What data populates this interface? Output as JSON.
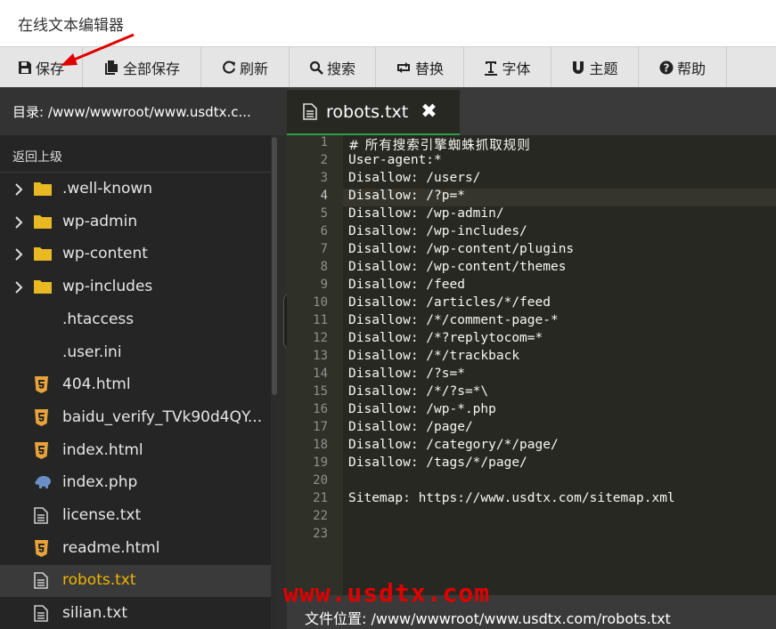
{
  "app": {
    "title": "在线文本编辑器"
  },
  "toolbar": {
    "buttons": [
      {
        "label": "保存",
        "icon": "save-icon"
      },
      {
        "label": "全部保存",
        "icon": "save-all-icon"
      },
      {
        "label": "刷新",
        "icon": "refresh-icon"
      },
      {
        "label": "搜索",
        "icon": "search-icon"
      },
      {
        "label": "替换",
        "icon": "replace-icon"
      },
      {
        "label": "字体",
        "icon": "font-icon"
      },
      {
        "label": "主题",
        "icon": "theme-icon"
      },
      {
        "label": "帮助",
        "icon": "help-icon"
      }
    ]
  },
  "directory": {
    "label": "目录: /www/wwwroot/www.usdtx.c..."
  },
  "sidebar": {
    "back_label": "返回上级",
    "items": [
      {
        "name": ".well-known",
        "type": "folder"
      },
      {
        "name": "wp-admin",
        "type": "folder"
      },
      {
        "name": "wp-content",
        "type": "folder"
      },
      {
        "name": "wp-includes",
        "type": "folder"
      },
      {
        "name": ".htaccess",
        "type": "plain"
      },
      {
        "name": ".user.ini",
        "type": "plain"
      },
      {
        "name": "404.html",
        "type": "html"
      },
      {
        "name": "baidu_verify_TVk90d4QY...",
        "type": "html"
      },
      {
        "name": "index.html",
        "type": "html"
      },
      {
        "name": "index.php",
        "type": "php"
      },
      {
        "name": "license.txt",
        "type": "txt"
      },
      {
        "name": "readme.html",
        "type": "html"
      },
      {
        "name": "robots.txt",
        "type": "txt",
        "active": true
      },
      {
        "name": "silian.txt",
        "type": "txt"
      }
    ]
  },
  "tab": {
    "label": "robots.txt",
    "icon": "file-text-icon",
    "close": "✖"
  },
  "editor": {
    "current_line": 4,
    "lines": [
      "# 所有搜索引擎蜘蛛抓取规则",
      "User-agent:*",
      "Disallow: /users/",
      "Disallow: /?p=*",
      "Disallow: /wp-admin/",
      "Disallow: /wp-includes/",
      "Disallow: /wp-content/plugins",
      "Disallow: /wp-content/themes",
      "Disallow: /feed",
      "Disallow: /articles/*/feed",
      "Disallow: /*/comment-page-*",
      "Disallow: /*?replytocom=*",
      "Disallow: /*/trackback",
      "Disallow: /?s=*",
      "Disallow: /*/?s=*\\",
      "Disallow: /wp-*.php",
      "Disallow: /page/",
      "Disallow: /category/*/page/",
      "Disallow: /tags/*/page/",
      "",
      "Sitemap: https://www.usdtx.com/sitemap.xml",
      "",
      ""
    ]
  },
  "status": {
    "label": "文件位置: /www/wwwroot/www.usdtx.com/robots.txt"
  },
  "watermark": {
    "text": "www.usdtx.com"
  },
  "colors": {
    "active_file": "#f0b400",
    "folder": "#e8b923",
    "html": "#e8a33a",
    "php": "#6a8fc8",
    "tab_accent": "#2e9e4a",
    "watermark": "#e00000"
  }
}
